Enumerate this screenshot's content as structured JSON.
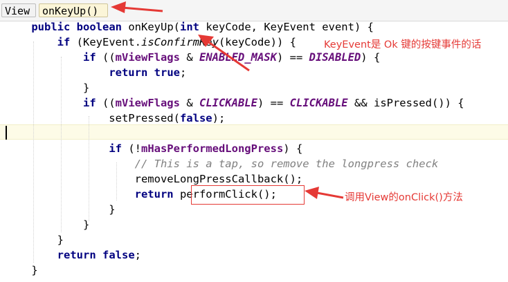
{
  "breadcrumbs": [
    "View",
    "onKeyUp()"
  ],
  "code": [
    [
      {
        "t": "    "
      },
      {
        "t": "public",
        "c": "kw"
      },
      {
        "t": " "
      },
      {
        "t": "boolean",
        "c": "kw"
      },
      {
        "t": " onKeyUp("
      },
      {
        "t": "int",
        "c": "kw"
      },
      {
        "t": " keyCode, KeyEvent event) {"
      }
    ],
    [
      {
        "t": "        "
      },
      {
        "t": "if",
        "c": "kw"
      },
      {
        "t": " (KeyEvent."
      },
      {
        "t": "isConfirmKey",
        "c": "ital"
      },
      {
        "t": "(keyCode)) {"
      }
    ],
    [
      {
        "t": "            "
      },
      {
        "t": "if",
        "c": "kw"
      },
      {
        "t": " (("
      },
      {
        "t": "mViewFlags",
        "c": "fld"
      },
      {
        "t": " & "
      },
      {
        "t": "ENABLED_MASK",
        "c": "cst"
      },
      {
        "t": ") == "
      },
      {
        "t": "DISABLED",
        "c": "cst"
      },
      {
        "t": ") {"
      }
    ],
    [
      {
        "t": "                "
      },
      {
        "t": "return",
        "c": "kw"
      },
      {
        "t": " "
      },
      {
        "t": "true",
        "c": "kw"
      },
      {
        "t": ";"
      }
    ],
    [
      {
        "t": "            }"
      }
    ],
    [
      {
        "t": "            "
      },
      {
        "t": "if",
        "c": "kw"
      },
      {
        "t": " (("
      },
      {
        "t": "mViewFlags",
        "c": "fld"
      },
      {
        "t": " & "
      },
      {
        "t": "CLICKABLE",
        "c": "cst"
      },
      {
        "t": ") == "
      },
      {
        "t": "CLICKABLE",
        "c": "cst"
      },
      {
        "t": " && isPressed()) {"
      }
    ],
    [
      {
        "t": "                setPressed("
      },
      {
        "t": "false",
        "c": "kw"
      },
      {
        "t": ");"
      }
    ],
    [],
    [
      {
        "t": "                "
      },
      {
        "t": "if",
        "c": "kw"
      },
      {
        "t": " (!"
      },
      {
        "t": "mHasPerformedLongPress",
        "c": "fld"
      },
      {
        "t": ") {"
      }
    ],
    [
      {
        "t": "                    "
      },
      {
        "t": "// This is a tap, so remove the longpress check",
        "c": "cmt"
      }
    ],
    [
      {
        "t": "                    removeLongPressCallback();"
      }
    ],
    [
      {
        "t": "                    "
      },
      {
        "t": "return",
        "c": "kw"
      },
      {
        "t": " performClick();"
      }
    ],
    [
      {
        "t": "                }"
      }
    ],
    [
      {
        "t": "            }"
      }
    ],
    [
      {
        "t": "        }"
      }
    ],
    [
      {
        "t": "        "
      },
      {
        "t": "return",
        "c": "kw"
      },
      {
        "t": " "
      },
      {
        "t": "false",
        "c": "kw"
      },
      {
        "t": ";"
      }
    ],
    [
      {
        "t": "    }"
      }
    ]
  ],
  "annotations": {
    "confirm_key_note": "KeyEvent是 Ok 键的按键事件的话",
    "perform_click_note": "调用View的onClick()方法"
  },
  "colors": {
    "annotation_red": "#e53935",
    "keyword": "#000080",
    "field": "#660e7a",
    "comment": "#808080"
  }
}
